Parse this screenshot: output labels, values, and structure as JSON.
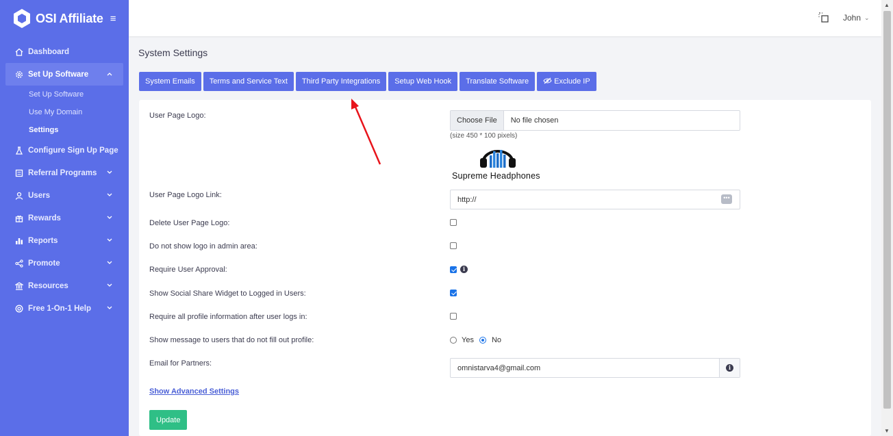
{
  "brand": {
    "name": "OSI Affiliate"
  },
  "sidebar": {
    "items": [
      {
        "label": "Dashboard",
        "icon": "home-icon"
      },
      {
        "label": "Set Up Software",
        "icon": "gear-icon",
        "active": true,
        "children": [
          "Set Up Software",
          "Use My Domain",
          "Settings"
        ]
      },
      {
        "label": "Configure Sign Up Page",
        "icon": "flask-icon"
      },
      {
        "label": "Referral Programs",
        "icon": "list-icon"
      },
      {
        "label": "Users",
        "icon": "user-icon"
      },
      {
        "label": "Rewards",
        "icon": "gift-icon"
      },
      {
        "label": "Reports",
        "icon": "bar-chart-icon"
      },
      {
        "label": "Promote",
        "icon": "share-icon"
      },
      {
        "label": "Resources",
        "icon": "bank-icon"
      },
      {
        "label": "Free 1-On-1 Help",
        "icon": "lifebuoy-icon"
      }
    ],
    "current_sub": "Settings"
  },
  "topbar": {
    "user": "John"
  },
  "page": {
    "title": "System Settings"
  },
  "tabs": [
    "System Emails",
    "Terms and Service Text",
    "Third Party Integrations",
    "Setup Web Hook",
    "Translate Software",
    "Exclude IP"
  ],
  "form": {
    "logo_label": "User Page Logo:",
    "choose_file": "Choose File",
    "file_status": "No file chosen",
    "size_hint": "(size 450 * 100 pixels)",
    "logo_preview_text": "Supreme Headphones",
    "logo_link_label": "User Page Logo Link:",
    "logo_link_value": "http://",
    "delete_logo_label": "Delete User Page Logo:",
    "hide_logo_admin_label": "Do not show logo in admin area:",
    "require_approval_label": "Require User Approval:",
    "social_widget_label": "Show Social Share Widget to Logged in Users:",
    "require_profile_label": "Require all profile information after user logs in:",
    "show_message_label": "Show message to users that do not fill out profile:",
    "yes": "Yes",
    "no": "No",
    "email_label": "Email for Partners:",
    "email_value": "omnistarva4@gmail.com",
    "advanced_link": "Show Advanced Settings",
    "update": "Update"
  },
  "colors": {
    "sidebar": "#5b6ee8",
    "tab": "#5b6ee8",
    "update": "#2fbf86",
    "annotation_arrow": "#e8141b"
  }
}
